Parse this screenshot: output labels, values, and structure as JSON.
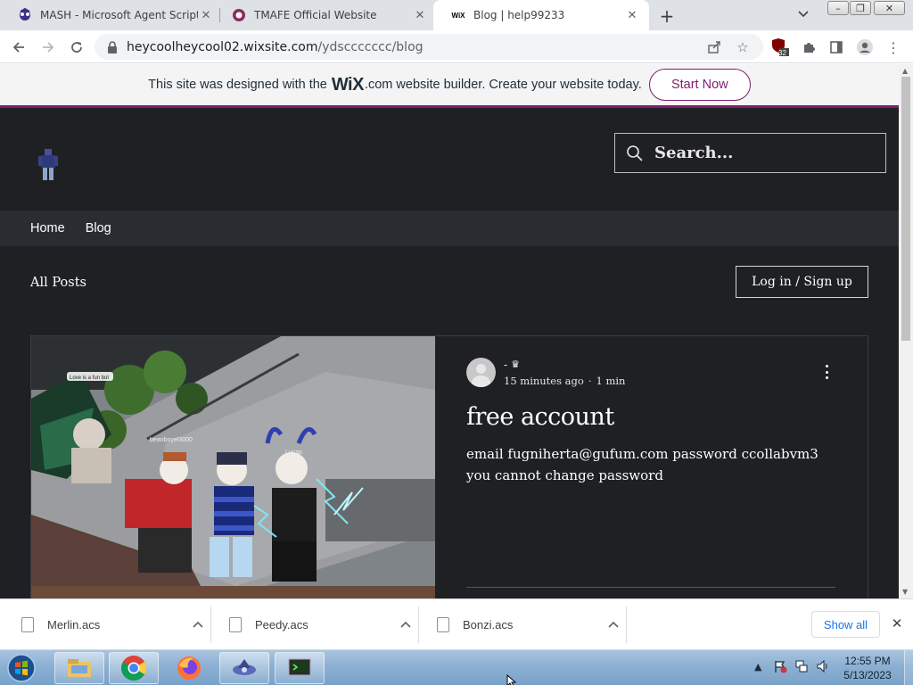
{
  "browser": {
    "tabs": [
      {
        "title": "MASH - Microsoft Agent Scriptin",
        "favicon": "mash-icon",
        "active": false
      },
      {
        "title": "TMAFE Official Website",
        "favicon": "tmafe-icon",
        "active": false
      },
      {
        "title": "Blog | help99233",
        "favicon": "wix-icon",
        "active": true
      }
    ],
    "address": {
      "host": "heycoolheycool02.wixsite.com",
      "path": "/ydsccccccc/blog"
    },
    "extension_badge": "32"
  },
  "wix_banner": {
    "prefix": "This site was designed with the",
    "logo": "WiX",
    "suffix": ".com website builder. Create your website today.",
    "cta": "Start Now",
    "accent": "#7e1e6e"
  },
  "site": {
    "search_placeholder": "Search...",
    "nav": [
      "Home",
      "Blog"
    ],
    "all_posts": "All Posts",
    "login": "Log in / Sign up",
    "background": "#1f2024"
  },
  "post": {
    "author": "-",
    "time": "15 minutes ago",
    "read_time": "1 min",
    "title": "free account",
    "excerpt": "email fugniherta@gufum.com password ccollabvm3 you cannot change password",
    "image_labels": [
      "Love is a fun bot",
      "Lucas",
      "beanboyel3000"
    ]
  },
  "downloads": {
    "items": [
      "Merlin.acs",
      "Peedy.acs",
      "Bonzi.acs"
    ],
    "show_all": "Show all"
  },
  "taskbar": {
    "time": "12:55 PM",
    "date": "5/13/2023"
  }
}
